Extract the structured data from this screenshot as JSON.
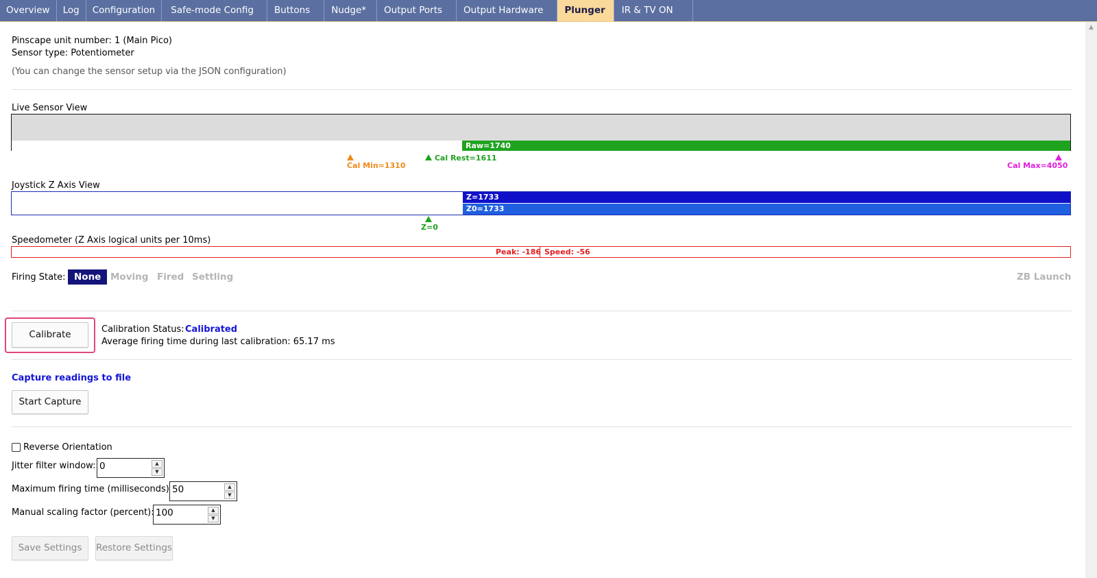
{
  "tabs": [
    {
      "label": "Overview"
    },
    {
      "label": "Log"
    },
    {
      "label": "Configuration"
    },
    {
      "label": "Safe-mode Config"
    },
    {
      "label": "Buttons"
    },
    {
      "label": "Nudge*"
    },
    {
      "label": "Output Ports"
    },
    {
      "label": "Output Hardware"
    },
    {
      "label": "Plunger"
    },
    {
      "label": "IR & TV ON"
    }
  ],
  "active_tab": "Plunger",
  "info": {
    "unit_number": "Pinscape unit number: 1 (Main Pico)",
    "sensor_type": "Sensor type: Potentiometer",
    "note": "(You can change the sensor setup via the JSON configuration)"
  },
  "live_sensor": {
    "title": "Live Sensor View",
    "raw_label": "Raw=1740",
    "raw_value": 1740,
    "cal_min_label": "Cal Min=1310",
    "cal_rest_label": "Cal Rest=1611",
    "cal_max_label": "Cal Max=4050",
    "colors": {
      "raw": "#1fa31f",
      "cal_min": "#f08a1a",
      "cal_rest": "#1fa31f",
      "cal_max": "#e020e0"
    }
  },
  "joystick": {
    "title": "Joystick Z Axis View",
    "z_label": "Z=1733",
    "z0_label": "Z0=1733",
    "zero_label": "Z=0",
    "colors": {
      "z": "#1010c8",
      "z0": "#1f5fe0",
      "zero": "#1fa31f"
    }
  },
  "speedometer": {
    "title": "Speedometer (Z Axis logical units per 10ms)",
    "peak_label": "Peak: -186",
    "speed_label": "Speed: -56",
    "color": "#e02020"
  },
  "firing_state": {
    "label": "Firing State:",
    "states": [
      "None",
      "Moving",
      "Fired",
      "Settling"
    ],
    "active": "None",
    "zb_launch": "ZB Launch"
  },
  "calibration": {
    "button": "Calibrate",
    "status_label": "Calibration Status:",
    "status_value": "Calibrated",
    "avg_time": "Average firing time during last calibration: 65.17 ms"
  },
  "capture": {
    "title": "Capture readings to file",
    "button": "Start Capture"
  },
  "settings": {
    "reverse_label": "Reverse Orientation",
    "reverse_checked": false,
    "jitter_label": "Jitter filter window:",
    "jitter_value": "0",
    "max_firing_label": "Maximum firing time (milliseconds):",
    "max_firing_value": "50",
    "scaling_label": "Manual scaling factor (percent):",
    "scaling_value": "100",
    "save_button": "Save Settings",
    "restore_button": "Restore Settings"
  }
}
